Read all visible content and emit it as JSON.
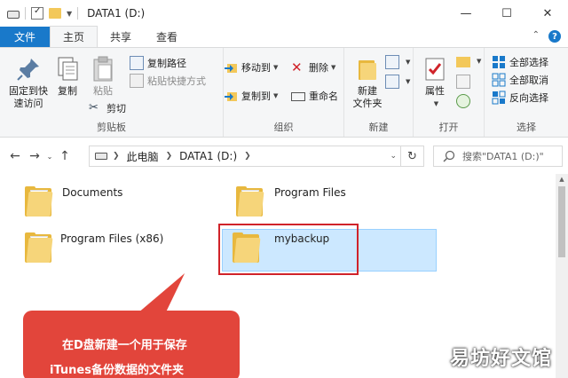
{
  "window": {
    "title": "DATA1 (D:)",
    "controls": {
      "minimize": "—",
      "maximize": "☐",
      "close": "✕"
    }
  },
  "tabs": [
    {
      "label": "文件"
    },
    {
      "label": "主页"
    },
    {
      "label": "共享"
    },
    {
      "label": "查看"
    }
  ],
  "ribbon": {
    "clipboard": {
      "pin_label_1": "固定到快",
      "pin_label_2": "速访问",
      "copy_label": "复制",
      "paste_label": "粘贴",
      "copy_path": "复制路径",
      "paste_shortcut": "粘贴快捷方式",
      "cut": "剪切",
      "group_label": "剪贴板"
    },
    "organize": {
      "move_to": "移动到",
      "copy_to": "复制到",
      "delete": "删除",
      "rename": "重命名",
      "group_label": "组织"
    },
    "new": {
      "new_folder_1": "新建",
      "new_folder_2": "文件夹",
      "group_label": "新建"
    },
    "open": {
      "properties": "属性",
      "group_label": "打开"
    },
    "select": {
      "select_all": "全部选择",
      "select_none": "全部取消",
      "invert": "反向选择",
      "group_label": "选择"
    }
  },
  "address": {
    "crumbs": [
      "此电脑",
      "DATA1 (D:)"
    ],
    "search_placeholder": "搜索\"DATA1 (D:)\""
  },
  "files": [
    {
      "name": "Documents"
    },
    {
      "name": "Program Files"
    },
    {
      "name": "Program Files (x86)"
    },
    {
      "name": "mybackup"
    }
  ],
  "callout": {
    "line1": "在D盘新建一个用于保存",
    "line2": "iTunes备份数据的文件夹"
  },
  "watermark": "易坊好文馆",
  "colors": {
    "file_tab": "#1979ca",
    "selection": "#cce8ff",
    "highlight": "#d0232a",
    "callout": "#e2453b"
  }
}
